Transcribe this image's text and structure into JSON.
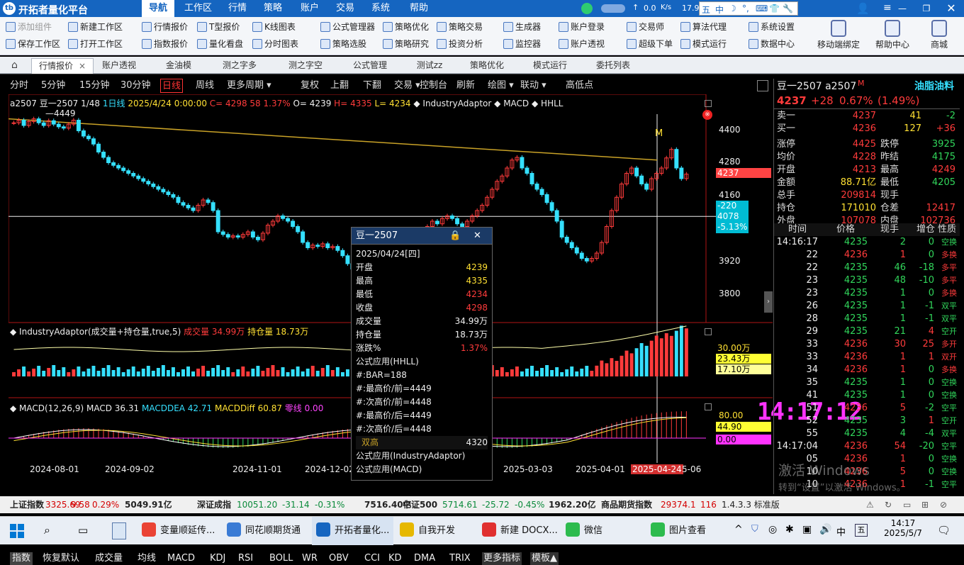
{
  "titlebar": {
    "app_title": "开拓者量化平台",
    "logo": "tb",
    "menus": [
      "导航",
      "工作区",
      "行情",
      "策略",
      "账户",
      "交易",
      "系统",
      "帮助"
    ],
    "active_menu": "导航",
    "net_speed": "0.0",
    "net_unit": "K/s",
    "right_text": "17.9",
    "ime_items": [
      "五",
      "中",
      "☽",
      "°,",
      "⌨",
      "👕",
      "🔧"
    ]
  },
  "toolbar": {
    "items": [
      [
        "添加组件",
        "保存工作区"
      ],
      [
        "新建工作区",
        "打开工作区"
      ],
      [
        "行情报价",
        "指数报价"
      ],
      [
        "T型报价",
        "量化看盘"
      ],
      [
        "K线图表",
        "分时图表"
      ],
      [
        "公式管理器",
        "策略选股"
      ],
      [
        "策略优化",
        "策略研究"
      ],
      [
        "策略交易",
        "投资分析"
      ],
      [
        "生成器",
        "监控器"
      ],
      [
        "账户登录",
        "账户透视"
      ],
      [
        "交易师",
        "超级下单"
      ],
      [
        "算法代理",
        "模式运行"
      ],
      [
        "系统设置",
        "数据中心"
      ]
    ],
    "big_buttons": [
      "移动端绑定",
      "帮助中心",
      "商城"
    ]
  },
  "tabs": {
    "home_icon": "home-icon",
    "items": [
      "行情报价",
      "账户透视",
      "金油模",
      "测之字多",
      "测之字空",
      "公式管理",
      "测试zz",
      "策略优化",
      "模式运行",
      "委托列表"
    ],
    "active": "行情报价",
    "close": "×"
  },
  "periods": {
    "items": [
      "分时",
      "5分钟",
      "15分钟",
      "30分钟",
      "日线",
      "周线",
      "更多周期 ▾",
      "复权",
      "上翻",
      "下翻",
      "交易 ▾",
      "控制台",
      "刷新",
      "绘图 ▾",
      "联动 ▾",
      "高低点"
    ],
    "selected": "日线"
  },
  "chart_header": {
    "code": "a2507",
    "name": "豆一2507",
    "ratio": "1/48",
    "period": "1日线",
    "datetime": "2025/4/24 0:00:00",
    "close": "C= 4298",
    "change": "58",
    "pct": "1.37%",
    "open": "O= 4239",
    "high": "H= 4335",
    "low": "L= 4234",
    "ind1": "◆ IndustryAdaptor",
    "ind2": "◆ MACD",
    "ind3": "◆ HHLL",
    "peak_label": "4449",
    "marker": "M"
  },
  "price_axis": {
    "labels": [
      "4400",
      "4280",
      "4160",
      "3920",
      "3800"
    ],
    "current": "4237",
    "cross_change": "-220",
    "cross_price": "4078",
    "cross_pct": "-5.13%"
  },
  "volume_panel": {
    "title": "◆ IndustryAdaptor(成交量+持仓量,true,5)",
    "vol_label": "成交量 34.99万",
    "oi_label": "持仓量 18.73万",
    "axis_top": "30.00万",
    "val1": "23.43万",
    "val2": "17.10万"
  },
  "macd_panel": {
    "title": "◆ MACD(12,26,9)",
    "macd": "MACD 36.31",
    "dea": "MACDDEA 42.71",
    "diff": "MACDDiff 60.87",
    "zero": "零线 0.00",
    "axis_top": "80.00",
    "val1": "44.90",
    "val2": "0.00"
  },
  "time_axis": {
    "labels": [
      "2024-08-01",
      "2024-09-02",
      "2024-11-01",
      "2024-12-02",
      "2025-01-02",
      "2025-03-03",
      "2025-04-01"
    ],
    "cursor": "2025-04-24",
    "tail": "5-06"
  },
  "clock": "14:17:12",
  "chart_data": {
    "type": "candlestick",
    "instrument": "豆一2507",
    "period": "日线",
    "ylim": [
      3700,
      4500
    ],
    "peak": 4449,
    "hline": 4078,
    "last": 4237,
    "closes": [
      4430,
      4440,
      4420,
      4435,
      4445,
      4430,
      4420,
      4438,
      4425,
      4415,
      4410,
      4425,
      4440,
      4400,
      4380,
      4370,
      4350,
      4320,
      4300,
      4280,
      4270,
      4260,
      4250,
      4240,
      4230,
      4220,
      4210,
      4200,
      4190,
      4180,
      4170,
      4160,
      4150,
      4130,
      4120,
      4110,
      4100,
      4120,
      4140,
      4130,
      4100,
      4020,
      4010,
      4000,
      4005,
      4000,
      4010,
      4020,
      4000,
      3990,
      4015,
      4045,
      4060,
      4080,
      4070,
      4060,
      4040,
      4020,
      3980,
      3960,
      3970,
      3965,
      3975,
      3960,
      3965,
      3950,
      3930,
      3900,
      3880,
      3890,
      3900,
      3920,
      3930,
      3940,
      3960,
      3990,
      3970,
      3940,
      3920,
      3930,
      3960,
      4000,
      4020,
      4040,
      4060,
      4050,
      4070,
      4080,
      4070,
      4050,
      4040,
      4060,
      4080,
      4100,
      4120,
      4150,
      4180,
      4210,
      4230,
      4260,
      4290,
      4300,
      4260,
      4240,
      4200,
      4180,
      4160,
      4130,
      4100,
      4060,
      4000,
      3980,
      3960,
      3940,
      3920,
      3910,
      3920,
      3940,
      3980,
      4040,
      4100,
      4150,
      4200,
      4240,
      4260,
      4230,
      4200,
      4180,
      4220,
      4240,
      4260,
      4298,
      4330,
      4260,
      4220,
      4237
    ]
  },
  "popup": {
    "title": "豆一2507",
    "date": "2025/04/24[四]",
    "rows": [
      [
        "开盘",
        "4239"
      ],
      [
        "最高",
        "4335"
      ],
      [
        "最低",
        "4234"
      ],
      [
        "收盘",
        "4298"
      ],
      [
        "成交量",
        "34.99万"
      ],
      [
        "持仓量",
        "18.73万"
      ],
      [
        "涨跌%",
        "1.37%"
      ]
    ],
    "formula1": "公式应用(HHLL)",
    "hhll": [
      "#:BAR=188",
      "#:最高价/前=4449",
      "#:次高价/前=4448",
      "#:最高价/后=4449",
      "#:次高价/后=4448"
    ],
    "double_top": "双高",
    "double_top_val": "4320",
    "formula2": "公式应用(IndustryAdaptor)",
    "formula3": "公式应用(MACD)"
  },
  "right_panel": {
    "code": "豆一2507 a2507",
    "flag": "M",
    "category": "油脂油料",
    "price": "4237",
    "chg": "+28",
    "pct": "0.67%",
    "pct2": "(1.49%)",
    "sell": [
      "卖一",
      "4237",
      "41",
      "-2"
    ],
    "buy": [
      "买一",
      "4236",
      "127",
      "+36"
    ],
    "stats": [
      [
        "涨停",
        "4425",
        "跌停",
        "3925"
      ],
      [
        "均价",
        "4228",
        "昨结",
        "4175"
      ],
      [
        "开盘",
        "4213",
        "最高",
        "4249"
      ],
      [
        "金额",
        "88.71亿",
        "最低",
        "4205"
      ],
      [
        "总手",
        "209814",
        "现手",
        ""
      ],
      [
        "持仓",
        "171010",
        "仓差",
        "12417"
      ],
      [
        "外盘",
        "107078",
        "内盘",
        "102736"
      ]
    ],
    "tick_headers": [
      "时间",
      "价格",
      "现手",
      "增仓",
      "性质"
    ],
    "ticks": [
      [
        "14:16:17",
        "4235",
        "2",
        "0",
        "空换"
      ],
      [
        "22",
        "4236",
        "1",
        "0",
        "多换"
      ],
      [
        "22",
        "4235",
        "46",
        "-18",
        "多平"
      ],
      [
        "23",
        "4235",
        "48",
        "-10",
        "多平"
      ],
      [
        "23",
        "4235",
        "1",
        "0",
        "多换"
      ],
      [
        "26",
        "4235",
        "1",
        "-1",
        "双平"
      ],
      [
        "28",
        "4235",
        "1",
        "-1",
        "双平"
      ],
      [
        "29",
        "4235",
        "21",
        "4",
        "空开"
      ],
      [
        "33",
        "4236",
        "30",
        "25",
        "多开"
      ],
      [
        "33",
        "4236",
        "1",
        "1",
        "双开"
      ],
      [
        "34",
        "4236",
        "1",
        "0",
        "多换"
      ],
      [
        "35",
        "4235",
        "1",
        "0",
        "空换"
      ],
      [
        "41",
        "4235",
        "1",
        "0",
        "空换"
      ],
      [
        "51",
        "4236",
        "5",
        "-2",
        "空平"
      ],
      [
        "52",
        "4235",
        "3",
        "1",
        "空开"
      ],
      [
        "55",
        "4235",
        "4",
        "-4",
        "双平"
      ],
      [
        "14:17:04",
        "4236",
        "54",
        "-20",
        "空平"
      ],
      [
        "05",
        "4236",
        "1",
        "0",
        "空换"
      ],
      [
        "10",
        "4236",
        "5",
        "0",
        "空换"
      ],
      [
        "10",
        "4236",
        "1",
        "-1",
        "空平"
      ]
    ]
  },
  "watermark": {
    "line1": "激活 Windows",
    "line2": "转到“设置”以激活 Windows。"
  },
  "bottom_tabs": [
    "指数",
    "恢复默认",
    "成交量",
    "均线",
    "MACD",
    "KDJ",
    "RSI",
    "BOLL",
    "WR",
    "OBV",
    "CCI",
    "KD",
    "DMA",
    "TRIX",
    "更多指标",
    "模板▲"
  ],
  "status": {
    "items": [
      [
        "上证指数",
        "3325.69",
        "9.58",
        "0.29%",
        "5049.91亿"
      ],
      [
        "深证成指",
        "10051.20",
        "-31.14",
        "-0.31%",
        "7516.40亿"
      ],
      [
        "中证500",
        "5714.61",
        "-25.72",
        "-0.45%",
        "1962.20亿"
      ],
      [
        "商品期货指数",
        "29374.1",
        "116",
        "",
        ""
      ]
    ],
    "version": "1.4.3.3 标准版"
  },
  "taskbar": {
    "apps": [
      "变量顺延传...",
      "同花顺期货通",
      "开拓者量化...",
      "自我开发",
      "新建 DOCX...",
      "微信",
      "图片查看"
    ],
    "time": "14:17",
    "date": "2025/5/7",
    "lang": "中",
    "ime": "五"
  },
  "colors": {
    "up": "#ff3b3b",
    "down": "#31d65b",
    "accent": "#1565c0"
  }
}
